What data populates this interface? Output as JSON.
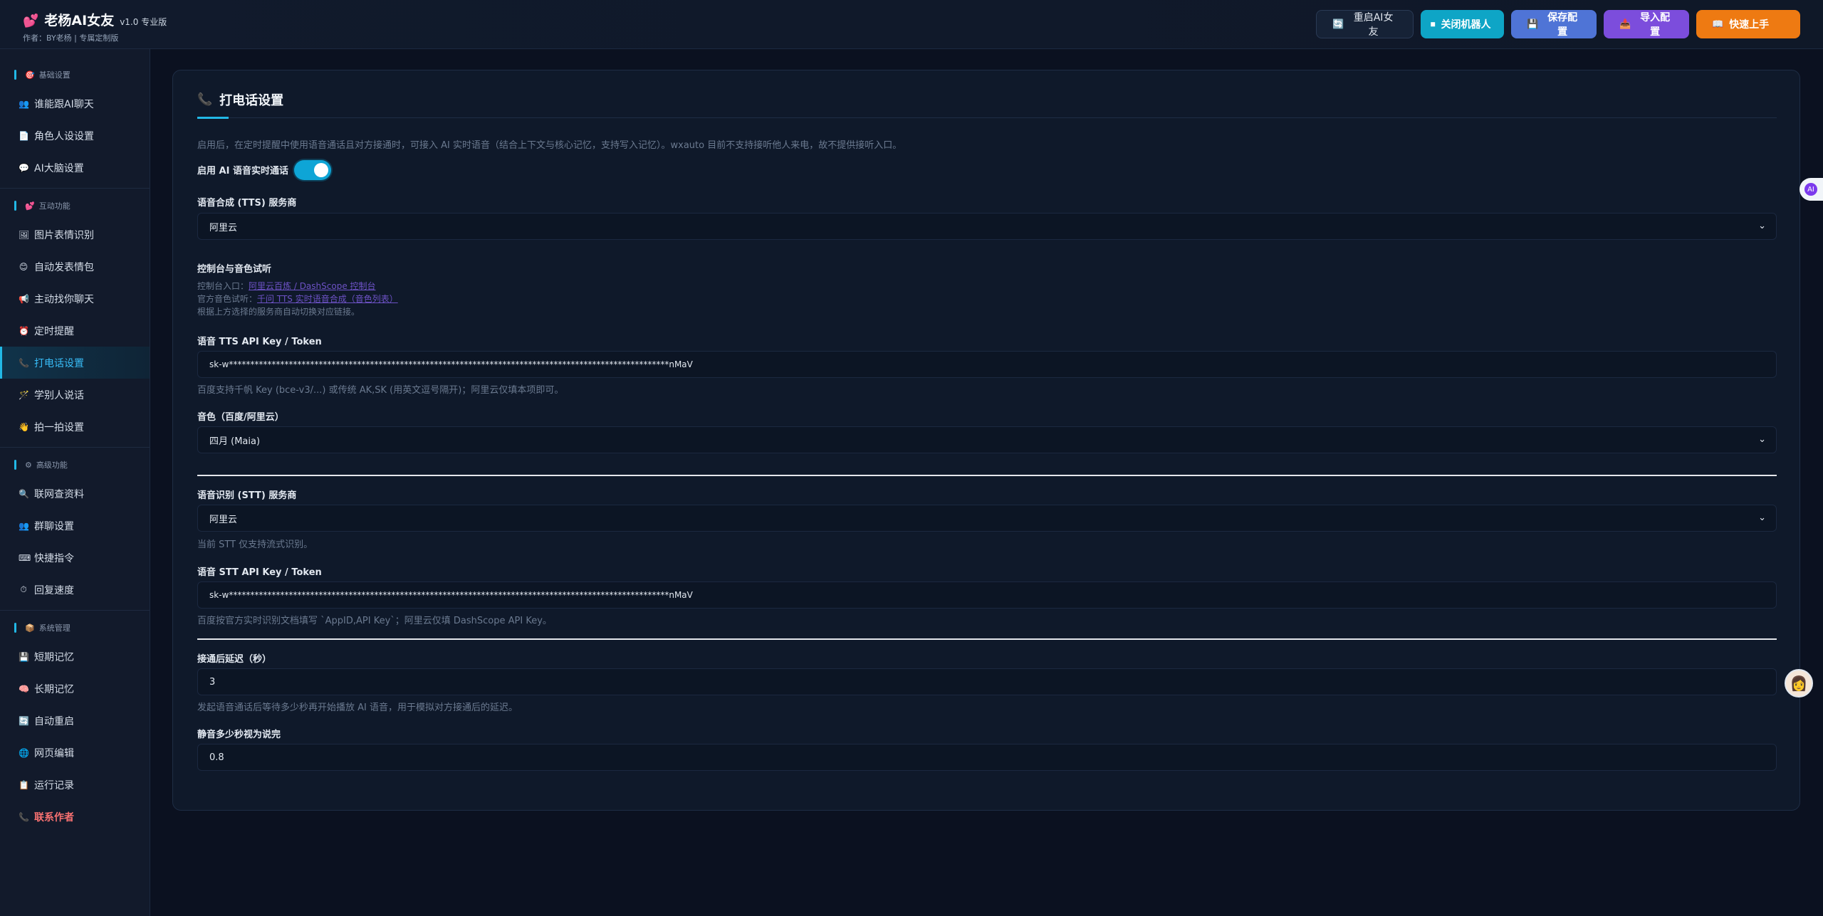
{
  "header": {
    "brand_icon": "💕",
    "title": "老杨AI女友",
    "version": "v1.0 专业版",
    "author": "作者：BY老杨 | 专属定制版",
    "buttons": {
      "restart": {
        "icon": "🔄",
        "label": "重启AI女友"
      },
      "close": {
        "icon": "⏹",
        "label": "关闭机器人"
      },
      "save": {
        "icon": "💾",
        "label": "保存配置"
      },
      "import": {
        "icon": "📥",
        "label": "导入配置"
      },
      "quick": {
        "icon": "📖",
        "label": "快速上手"
      }
    }
  },
  "sidebar": {
    "sections": [
      {
        "icon": "🎯",
        "title": "基础设置",
        "items": [
          {
            "icon": "👥",
            "label": "谁能跟AI聊天"
          },
          {
            "icon": "📄",
            "label": "角色人设设置"
          },
          {
            "icon": "💬",
            "label": "AI大脑设置"
          }
        ]
      },
      {
        "icon": "💕",
        "title": "互动功能",
        "items": [
          {
            "icon": "🖼",
            "label": "图片表情识别"
          },
          {
            "icon": "😊",
            "label": "自动发表情包"
          },
          {
            "icon": "📢",
            "label": "主动找你聊天"
          },
          {
            "icon": "⏰",
            "label": "定时提醒"
          },
          {
            "icon": "📞",
            "label": "打电话设置",
            "active": true
          },
          {
            "icon": "🪄",
            "label": "学别人说话"
          },
          {
            "icon": "👋",
            "label": "拍一拍设置"
          }
        ]
      },
      {
        "icon": "⚙",
        "title": "高级功能",
        "items": [
          {
            "icon": "🔍",
            "label": "联网查资料"
          },
          {
            "icon": "👥",
            "label": "群聊设置"
          },
          {
            "icon": "⌨",
            "label": "快捷指令"
          },
          {
            "icon": "⏱",
            "label": "回复速度"
          }
        ]
      },
      {
        "icon": "📦",
        "title": "系统管理",
        "items": [
          {
            "icon": "💾",
            "label": "短期记忆"
          },
          {
            "icon": "🧠",
            "label": "长期记忆"
          },
          {
            "icon": "🔄",
            "label": "自动重启"
          },
          {
            "icon": "🌐",
            "label": "网页编辑"
          },
          {
            "icon": "📋",
            "label": "运行记录"
          }
        ]
      }
    ],
    "author_link": {
      "icon": "📞",
      "label": "联系作者"
    }
  },
  "main": {
    "title_icon": "📞",
    "title": "打电话设置",
    "intro": "启用后，在定时提醒中使用语音通话且对方接通时，可接入 AI 实时语音（结合上下文与核心记忆，支持写入记忆）。wxauto 目前不支持接听他人来电，故不提供接听入口。",
    "enable_label": "启用 AI 语音实时通话",
    "enable_on": true,
    "tts_provider_label": "语音合成 (TTS) 服务商",
    "tts_provider_value": "阿里云",
    "console_label": "控制台与音色试听",
    "console_entry_prefix": "控制台入口：",
    "console_entry_link": "阿里云百炼 / DashScope 控制台",
    "voice_demo_prefix": "官方音色试听：",
    "voice_demo_link": "千问 TTS 实时语音合成（音色列表）",
    "auto_switch_note": "根据上方选择的服务商自动切换对应链接。",
    "tts_key_label": "语音 TTS API Key / Token",
    "tts_key_value": "sk-w*******************************************************************************************************nMaV",
    "tts_key_hint": "百度支持千帆 Key (bce-v3/...) 或传统 AK,SK (用英文逗号隔开)；阿里云仅填本项即可。",
    "voice_label": "音色（百度/阿里云）",
    "voice_value": "四月 (Maia)",
    "stt_provider_label": "语音识别 (STT) 服务商",
    "stt_provider_value": "阿里云",
    "stt_note": "当前 STT 仅支持流式识别。",
    "stt_key_label": "语音 STT API Key / Token",
    "stt_key_value": "sk-w*******************************************************************************************************nMaV",
    "stt_key_hint": "百度按官方实时识别文档填写 `AppID,API Key`；阿里云仅填 DashScope API Key。",
    "delay_label": "接通后延迟（秒）",
    "delay_value": "3",
    "delay_hint": "发起语音通话后等待多少秒再开始播放 AI 语音，用于模拟对方接通后的延迟。",
    "silence_label": "静音多少秒视为说完",
    "silence_value": "0.8"
  },
  "floating": {
    "assistant_badge": "AI",
    "avatar_icon": "👩"
  }
}
